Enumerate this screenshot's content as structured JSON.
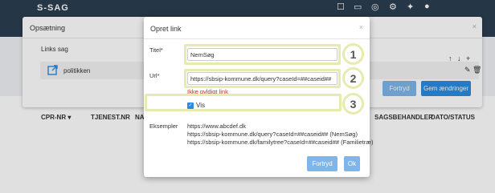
{
  "app": {
    "brand": "S-SAG"
  },
  "table": {
    "headers": [
      "CPR-NR ▾",
      "TJENEST.NR",
      "NA",
      "SAGSBEHANDLER",
      "DATO/STATUS"
    ]
  },
  "settings_modal": {
    "title": "Opsætning",
    "links_label": "Links sag",
    "link_item": "politikken",
    "arrows": "↑ ↓ +",
    "cancel_label": "Fortryd",
    "save_label": "Gem ændringer"
  },
  "link_dialog": {
    "title": "Opret link",
    "close": "×",
    "title_label": "Titel*",
    "title_value": "NemSøg",
    "url_label": "Url*",
    "url_value": "https://sbsip-kommune.dk/query?caseId=##caseid##",
    "error": "Ikke gyldigt link",
    "visible_label": "Vis",
    "examples_label": "Eksempler",
    "examples": [
      "https://www.abcdef.dk",
      "https://sbsip-kommune.dk/query?caseId=##caseid## (NemSøg)",
      "https://sbsip-kommune.dk/familytree?caseId=##caseid## (Familietræ)"
    ],
    "cancel_label": "Fortryd",
    "ok_label": "Ok"
  },
  "steps": [
    "1",
    "2",
    "3"
  ],
  "colors": {
    "primary": "#2a8be0",
    "error": "#e0231c",
    "highlight": "#e8ebb0",
    "topbar": "#2b3e50"
  }
}
